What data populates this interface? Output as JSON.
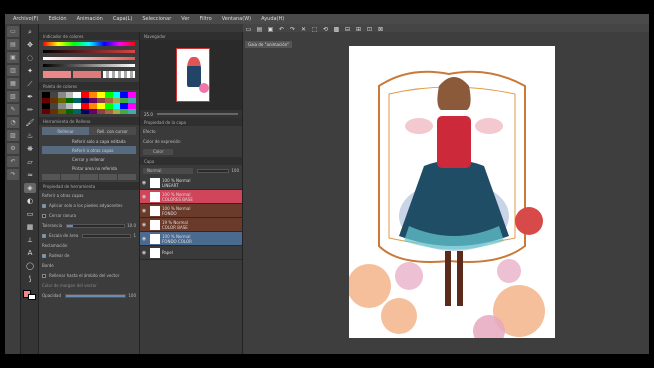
{
  "menu": [
    "Archivo(F)",
    "Edición",
    "Animación",
    "Capa(L)",
    "Seleccionar",
    "Ver",
    "Filtro",
    "Ventana(W)",
    "Ayuda(H)"
  ],
  "panels": {
    "color_title": "Indicador de colores",
    "color_values": [
      "0",
      "0",
      "0",
      "0",
      "0",
      "0"
    ],
    "sub_title": "Herramienta de Relleno",
    "tool_prop_title": "Propiedad de herramienta",
    "fill_tab": "Rellenar",
    "paint_tab": "Rell. con cursor",
    "fill_opts": [
      "Referir solo a capa editada",
      "Referir a otras capas",
      "Cerrar y rellenar",
      "Pintar area no referida"
    ],
    "ref_layers": "Referir a otras capas",
    "prop_rows": [
      "Aplicar solo a los pixeles adyacentes",
      "Cerrar ranura",
      "Tolerancia",
      "Escala de área",
      "Rodear de",
      "Borde",
      "Rellenar hasta el ámbito del vector",
      "Opacidad"
    ],
    "tolerance": "10.0",
    "expand": "1",
    "area_scale": "1",
    "opacity": "100",
    "rodear_label": "Reclamación",
    "bottom_label": "Color de margen del vector"
  },
  "navigator_title": "Navegador",
  "layer_prop_title": "Propiedad de la capa",
  "effect_label": "Efecto",
  "expression_label": "Color de expresión",
  "expression_value": "Color",
  "layers_title": "Capa",
  "blend_mode": "Normal",
  "blend_value": "100",
  "layers": [
    {
      "line1": "100 % Normal",
      "line2": "LINEART",
      "color": "#3a3a3a"
    },
    {
      "line1": "100 % Normal",
      "line2": "COLORES BASE",
      "color": "#d0455a"
    },
    {
      "line1": "100 % Normal",
      "line2": "FONDO",
      "color": "#6a3a2a"
    },
    {
      "line1": "19 % Normal",
      "line2": "COLOR BASE",
      "color": "#6a3a2a"
    },
    {
      "line1": "100 % Normal",
      "line2": "FONDO COLOR",
      "color": "#4a6a90"
    },
    {
      "line1": "Papel",
      "line2": "",
      "color": "#3a3a3a"
    }
  ],
  "canvas_tab": "Gaia de \"animación\"",
  "zoom": "25.0",
  "colors": {
    "accent": "#566b80",
    "paper": "#ffffff"
  }
}
